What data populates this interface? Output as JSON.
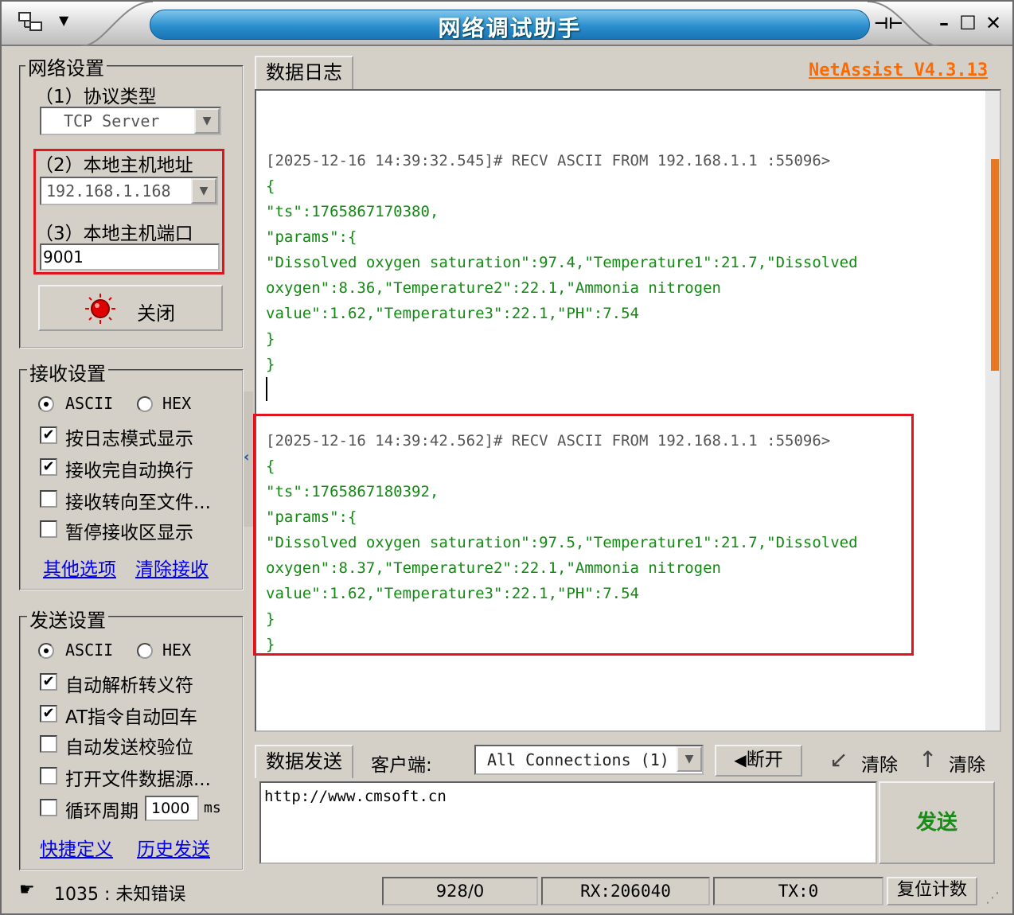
{
  "window": {
    "title": "网络调试助手",
    "brand_link": "NetAssist V4.3.13"
  },
  "network_settings": {
    "group_title": "网络设置",
    "protocol_label": "（1）协议类型",
    "protocol_value": "TCP Server",
    "host_label": "（2）本地主机地址",
    "host_value": "192.168.1.168",
    "port_label": "（3）本地主机端口",
    "port_value": "9001",
    "close_button": "关闭"
  },
  "receive_settings": {
    "group_title": "接收设置",
    "radio_ascii": "ASCII",
    "radio_hex": "HEX",
    "checkboxes": [
      {
        "label": "按日志模式显示",
        "checked": true
      },
      {
        "label": "接收完自动换行",
        "checked": true
      },
      {
        "label": "接收转向至文件...",
        "checked": false
      },
      {
        "label": "暂停接收区显示",
        "checked": false
      }
    ],
    "link_other": "其他选项",
    "link_clear": "清除接收"
  },
  "send_settings": {
    "group_title": "发送设置",
    "radio_ascii": "ASCII",
    "radio_hex": "HEX",
    "checkboxes": [
      {
        "label": "自动解析转义符",
        "checked": true
      },
      {
        "label": "AT指令自动回车",
        "checked": true
      },
      {
        "label": "自动发送校验位",
        "checked": false
      },
      {
        "label": "打开文件数据源...",
        "checked": false
      },
      {
        "label": "循环周期",
        "checked": false
      }
    ],
    "cycle_value": "1000",
    "cycle_unit": "ms",
    "link_shortcut": "快捷定义",
    "link_history": "历史发送"
  },
  "log": {
    "tab_label": "数据日志",
    "entries": [
      {
        "header": "[2025-12-16 14:39:32.545]# RECV ASCII FROM 192.168.1.1 :55096>",
        "lines": [
          "{",
          "\"ts\":1765867170380,",
          "\"params\":{",
          "\"Dissolved oxygen saturation\":97.4,\"Temperature1\":21.7,\"Dissolved",
          "oxygen\":8.36,\"Temperature2\":22.1,\"Ammonia nitrogen",
          "value\":1.62,\"Temperature3\":22.1,\"PH\":7.54",
          "}",
          "}"
        ]
      },
      {
        "header": "[2025-12-16 14:39:42.562]# RECV ASCII FROM 192.168.1.1 :55096>",
        "lines": [
          "{",
          "\"ts\":1765867180392,",
          "\"params\":{",
          "\"Dissolved oxygen saturation\":97.5,\"Temperature1\":21.7,\"Dissolved",
          "oxygen\":8.37,\"Temperature2\":22.1,\"Ammonia nitrogen",
          "value\":1.62,\"Temperature3\":22.1,\"PH\":7.54",
          "}",
          "}"
        ]
      }
    ]
  },
  "send_area": {
    "tab_label": "数据发送",
    "client_label": "客户端:",
    "client_value": "All Connections (1)",
    "disconnect_button": "断开",
    "clear_button_1": "清除",
    "clear_button_2": "清除",
    "send_text": "http://www.cmsoft.cn",
    "send_button": "发送"
  },
  "status_bar": {
    "message": "1035 : 未知错误",
    "counter": "928/0",
    "rx": "RX:206040",
    "tx": "TX:0",
    "reset_button": "复位计数"
  },
  "colors": {
    "accent_red": "#e0141e",
    "log_green": "#128a12",
    "brand_orange": "#ff6a00",
    "title_blue": "#2c8fce"
  }
}
